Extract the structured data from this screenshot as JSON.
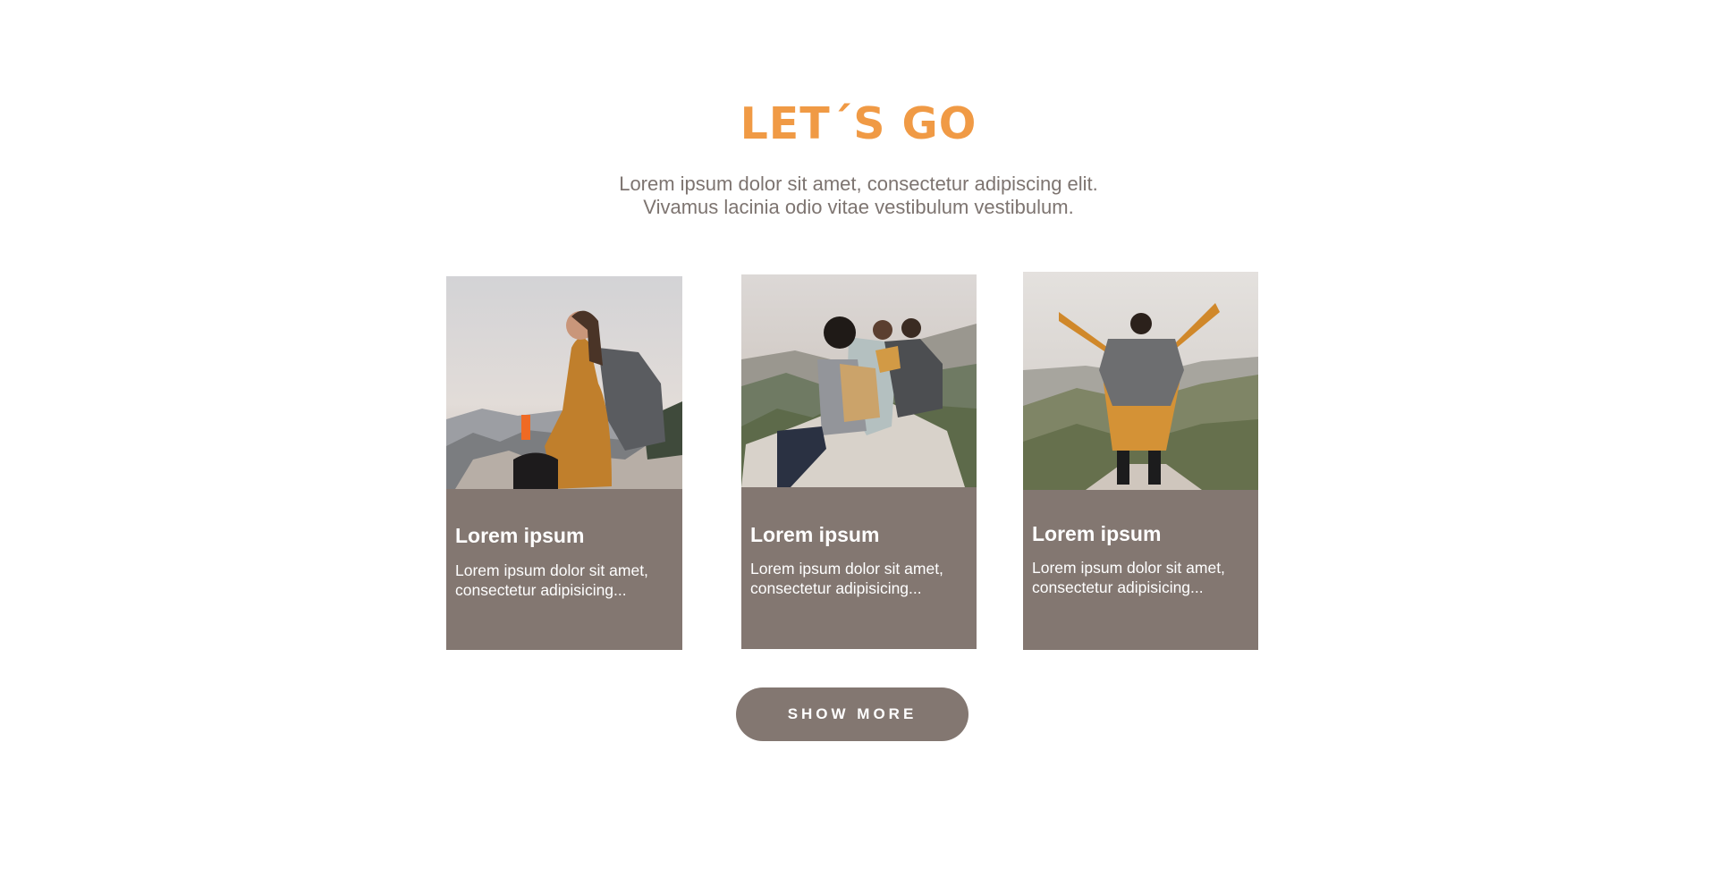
{
  "header": {
    "title": "LET´S GO",
    "subtitle_line1": "Lorem ipsum dolor sit amet, consectetur adipiscing elit.",
    "subtitle_line2": "Vivamus lacinia odio vitae vestibulum vestibulum."
  },
  "cards": [
    {
      "title": "Lorem ipsum",
      "text": "Lorem ipsum dolor sit amet, consectetur  adipisicing...",
      "image": "hiker-woman-sitting-on-rock-photo"
    },
    {
      "title": "Lorem ipsum",
      "text": "Lorem ipsum dolor sit amet, consectetur  adipisicing...",
      "image": "group-of-hikers-on-summit-photo"
    },
    {
      "title": "Lorem ipsum",
      "text": "Lorem ipsum dolor sit amet, consectetur  adipisicing...",
      "image": "hiker-arms-raised-on-peak-photo"
    }
  ],
  "actions": {
    "show_more_label": "SHOW MORE"
  },
  "colors": {
    "accent": "#f09a45",
    "card_background": "#837771",
    "subtitle_text": "#7d7470",
    "background": "#ffffff"
  }
}
